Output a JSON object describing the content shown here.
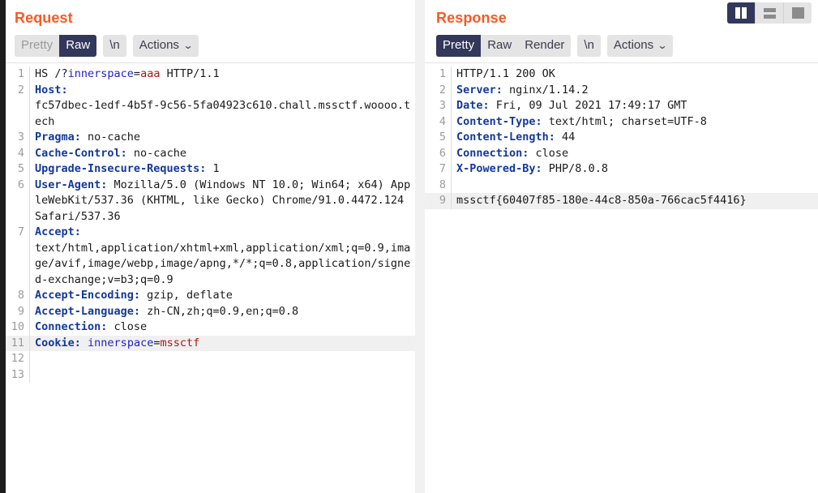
{
  "view_modes": [
    {
      "name": "side-by-side",
      "icon": "split-vertical-icon",
      "active": true
    },
    {
      "name": "stacked",
      "icon": "split-horizontal-icon",
      "active": false
    },
    {
      "name": "single-pane",
      "icon": "single-pane-icon",
      "active": false
    }
  ],
  "request": {
    "title": "Request",
    "toolbar": {
      "pretty": "Pretty",
      "raw": "Raw",
      "newline": "\\n",
      "actions": "Actions",
      "caret": "⌄",
      "selected": "Raw"
    },
    "lines": [
      {
        "n": "1",
        "segs": [
          {
            "t": "HS /?",
            "c": "plain"
          },
          {
            "t": "innerspace",
            "c": "p"
          },
          {
            "t": "=",
            "c": "plain"
          },
          {
            "t": "aaa",
            "c": "pv"
          },
          {
            "t": " HTTP/1.1",
            "c": "plain"
          }
        ]
      },
      {
        "n": "2",
        "segs": [
          {
            "t": "Host:",
            "c": "k"
          }
        ]
      },
      {
        "n": "",
        "segs": [
          {
            "t": "fc57dbec-1edf-4b5f-9c56-5fa04923c610.chall.mssctf.woooo.tech",
            "c": "plain"
          }
        ]
      },
      {
        "n": "3",
        "segs": [
          {
            "t": "Pragma:",
            "c": "k"
          },
          {
            "t": " no-cache",
            "c": "plain"
          }
        ]
      },
      {
        "n": "4",
        "segs": [
          {
            "t": "Cache-Control:",
            "c": "k"
          },
          {
            "t": " no-cache",
            "c": "plain"
          }
        ]
      },
      {
        "n": "5",
        "segs": [
          {
            "t": "Upgrade-Insecure-Requests:",
            "c": "k"
          },
          {
            "t": " 1",
            "c": "plain"
          }
        ]
      },
      {
        "n": "6",
        "segs": [
          {
            "t": "User-Agent:",
            "c": "k"
          },
          {
            "t": " Mozilla/5.0 (Windows NT 10.0; Win64; x64) AppleWebKit/537.36 (KHTML, like Gecko) Chrome/91.0.4472.124 Safari/537.36",
            "c": "plain"
          }
        ]
      },
      {
        "n": "7",
        "segs": [
          {
            "t": "Accept:",
            "c": "k"
          }
        ]
      },
      {
        "n": "",
        "segs": [
          {
            "t": "text/html,application/xhtml+xml,application/xml;q=0.9,image/avif,image/webp,image/apng,*/*;q=0.8,application/signed-exchange;v=b3;q=0.9",
            "c": "plain"
          }
        ]
      },
      {
        "n": "8",
        "segs": [
          {
            "t": "Accept-Encoding:",
            "c": "k"
          },
          {
            "t": " gzip, deflate",
            "c": "plain"
          }
        ]
      },
      {
        "n": "9",
        "segs": [
          {
            "t": "Accept-Language:",
            "c": "k"
          },
          {
            "t": " zh-CN,zh;q=0.9,en;q=0.8",
            "c": "plain"
          }
        ]
      },
      {
        "n": "10",
        "segs": [
          {
            "t": "Connection:",
            "c": "k"
          },
          {
            "t": " close",
            "c": "plain"
          }
        ]
      },
      {
        "n": "11",
        "hl": true,
        "segs": [
          {
            "t": "Cookie:",
            "c": "k"
          },
          {
            "t": " ",
            "c": "plain"
          },
          {
            "t": "innerspace",
            "c": "p"
          },
          {
            "t": "=",
            "c": "plain"
          },
          {
            "t": "mssctf",
            "c": "pv"
          }
        ]
      },
      {
        "n": "12",
        "segs": []
      },
      {
        "n": "13",
        "segs": []
      }
    ]
  },
  "response": {
    "title": "Response",
    "toolbar": {
      "pretty": "Pretty",
      "raw": "Raw",
      "render": "Render",
      "newline": "\\n",
      "actions": "Actions",
      "caret": "⌄",
      "selected": "Pretty"
    },
    "lines": [
      {
        "n": "1",
        "segs": [
          {
            "t": "HTTP/1.1 200 OK",
            "c": "plain"
          }
        ]
      },
      {
        "n": "2",
        "segs": [
          {
            "t": "Server:",
            "c": "k"
          },
          {
            "t": " nginx/1.14.2",
            "c": "plain"
          }
        ]
      },
      {
        "n": "3",
        "segs": [
          {
            "t": "Date:",
            "c": "k"
          },
          {
            "t": " Fri, 09 Jul 2021 17:49:17 GMT",
            "c": "plain"
          }
        ]
      },
      {
        "n": "4",
        "segs": [
          {
            "t": "Content-Type:",
            "c": "k"
          },
          {
            "t": " text/html; charset=UTF-8",
            "c": "plain"
          }
        ]
      },
      {
        "n": "5",
        "segs": [
          {
            "t": "Content-Length:",
            "c": "k"
          },
          {
            "t": " 44",
            "c": "plain"
          }
        ]
      },
      {
        "n": "6",
        "segs": [
          {
            "t": "Connection:",
            "c": "k"
          },
          {
            "t": " close",
            "c": "plain"
          }
        ]
      },
      {
        "n": "7",
        "segs": [
          {
            "t": "X-Powered-By:",
            "c": "k"
          },
          {
            "t": " PHP/8.0.8",
            "c": "plain"
          }
        ]
      },
      {
        "n": "8",
        "segs": []
      },
      {
        "n": "9",
        "hl": true,
        "segs": [
          {
            "t": "mssctf{60407f85-180e-44c8-850a-766cac5f4416}",
            "c": "plain"
          }
        ]
      }
    ]
  },
  "colors": {
    "title": "#ff5722",
    "selected_tab": "#33375c",
    "header_key": "#14389c",
    "param_name": "#2222cc",
    "param_value": "#b01414",
    "highlight_row": "#f0f0f0"
  }
}
